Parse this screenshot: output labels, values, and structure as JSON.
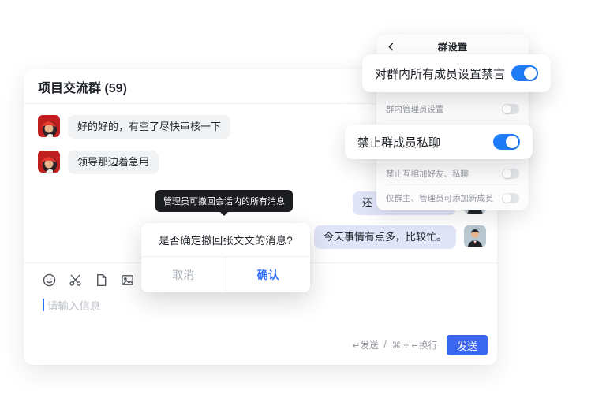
{
  "colors": {
    "accent_blue": "#3370ff",
    "toggle_on_blue": "#1f7cf9",
    "send_button_blue": "#3a66f0",
    "bubble_left": "#f2f3f5",
    "bubble_right": "#e1e5f8",
    "tooltip_bg": "#1b1d21"
  },
  "chat": {
    "title": "项目交流群 (59)",
    "messages": [
      {
        "side": "left",
        "text": "好的好的，有空了尽快审核一下"
      },
      {
        "side": "left",
        "text": "领导那边着急用"
      },
      {
        "side": "right",
        "text": "还"
      },
      {
        "side": "right",
        "text": "今天事情有点多，比较忙。"
      }
    ],
    "tooltip": "管理员可撤回会话内的所有消息",
    "dialog": {
      "question": "是否确定撤回张文文的消息?",
      "cancel": "取消",
      "confirm": "确认"
    },
    "composer": {
      "placeholder": "请输入信息",
      "icons": [
        "emoji-icon",
        "scissors-icon",
        "file-icon",
        "image-icon"
      ],
      "hint_enter": "↵发送",
      "hint_divider": "/",
      "hint_newline": "⌘ + ↵换行",
      "send": "发送"
    }
  },
  "settings": {
    "title": "群设置",
    "back_icon": "chevron-left-icon",
    "cards": [
      {
        "label": "对群内所有成员设置禁言",
        "on": true
      },
      {
        "label": "禁止群成员私聊",
        "on": true
      }
    ],
    "rows": [
      {
        "label": "群内管理员设置",
        "on": false
      },
      {
        "label": "禁止互相加好友、私聊",
        "on": false
      },
      {
        "label": "仅群主、管理员可添加新成员",
        "on": false
      }
    ]
  }
}
